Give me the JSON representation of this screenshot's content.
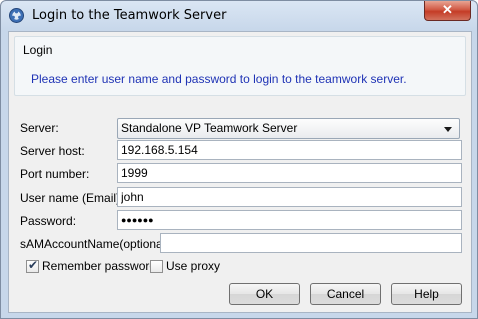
{
  "window": {
    "title": "Login to the Teamwork Server",
    "close_glyph": "✕"
  },
  "login_group": {
    "label": "Login",
    "message": "Please enter user name and password to login to the teamwork server."
  },
  "form": {
    "server_label": "Server:",
    "server_value": "Standalone VP Teamwork Server",
    "host_label": "Server host:",
    "host_value": "192.168.5.154",
    "port_label": "Port number:",
    "port_value": "1999",
    "username_label": "User name (Email):",
    "username_value": "john",
    "password_label": "Password:",
    "password_value": "●●●●●●",
    "sam_label": "sAMAccountName(optional):",
    "sam_value": ""
  },
  "options": {
    "remember_label": "Remember password",
    "remember_checked": true,
    "proxy_label": "Use proxy",
    "proxy_checked": false
  },
  "buttons": {
    "ok": "OK",
    "cancel": "Cancel",
    "help": "Help"
  },
  "colors": {
    "message": "#1f33b5",
    "title_bar": "#c7d7ea",
    "close_button": "#c43c26"
  },
  "icons": {
    "app": "teamwork-app-icon",
    "close": "close-icon",
    "dropdown": "chevron-down-icon",
    "check": "checkmark-icon"
  }
}
